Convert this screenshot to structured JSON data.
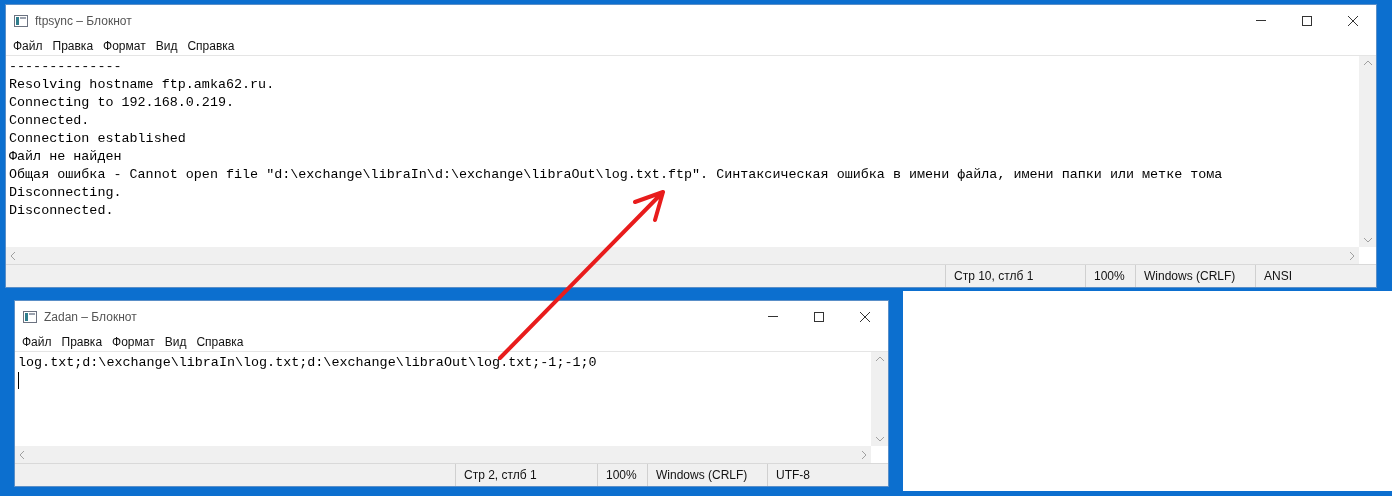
{
  "windows": [
    {
      "title": "ftpsync – Блокнот",
      "menu": [
        "Файл",
        "Правка",
        "Формат",
        "Вид",
        "Справка"
      ],
      "lines": [
        "--------------",
        "Resolving hostname ftp.amka62.ru.",
        "Connecting to 192.168.0.219.",
        "Connected.",
        "Connection established",
        "Файл не найден",
        "Общая ошибка - Cannot open file \"d:\\exchange\\libraIn\\d:\\exchange\\libraOut\\log.txt.ftp\". Синтаксическая ошибка в имени файла, имени папки или метке тома",
        "Disconnecting.",
        "Disconnected."
      ],
      "caret": false,
      "status": [
        "Стр 10, стлб 1",
        "100%",
        "Windows (CRLF)",
        "ANSI"
      ]
    },
    {
      "title": "Zadan – Блокнот",
      "menu": [
        "Файл",
        "Правка",
        "Формат",
        "Вид",
        "Справка"
      ],
      "lines": [
        "log.txt;d:\\exchange\\libraIn\\log.txt;d:\\exchange\\libraOut\\log.txt;-1;-1;0"
      ],
      "caret": true,
      "status": [
        "Стр 2, стлб 1",
        "100%",
        "Windows (CRLF)",
        "UTF-8"
      ]
    }
  ]
}
